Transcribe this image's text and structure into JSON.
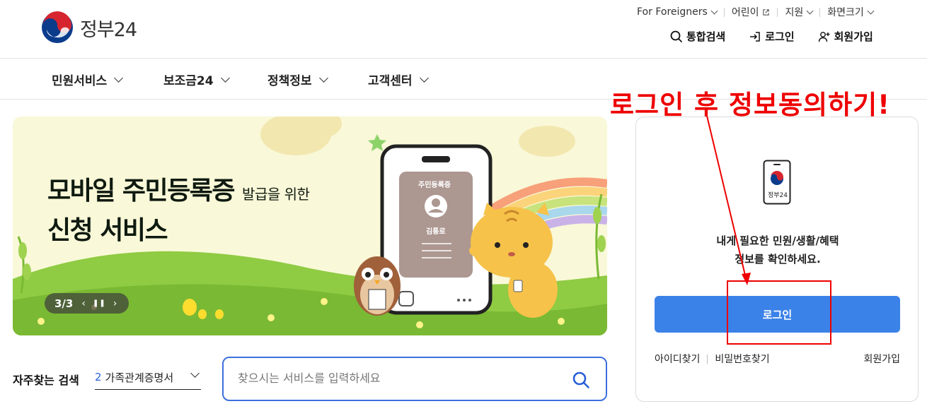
{
  "header": {
    "logo_text": "정부24",
    "util": {
      "foreigners": "For Foreigners",
      "kids": "어린이",
      "region": "지원",
      "font_size": "화면크기"
    },
    "actions": {
      "search": "통합검색",
      "login": "로그인",
      "signup": "회원가입"
    }
  },
  "nav": {
    "items": [
      {
        "label": "민원서비스"
      },
      {
        "label": "보조금24"
      },
      {
        "label": "정책정보"
      },
      {
        "label": "고객센터"
      }
    ]
  },
  "banner": {
    "title_main_1": "모바일 주민등록증",
    "title_small": "발급을 위한",
    "title_main_2": "신청 서비스",
    "card_title": "주민등록증",
    "card_name": "김통로",
    "pager": {
      "current": "3",
      "total": "3",
      "text": "3/3"
    }
  },
  "search": {
    "freq_label": "자주찾는 검색",
    "freq_number": "2",
    "freq_value": "가족관계증명서",
    "placeholder": "찾으시는 서비스를 입력하세요"
  },
  "login_card": {
    "icon_label": "정부24",
    "desc_line1": "내게 필요한 민원/생활/혜택",
    "desc_line2": "정보를 확인하세요.",
    "login_button": "로그인",
    "find_id": "아이디찾기",
    "find_pw": "비밀번호찾기",
    "signup": "회원가입"
  },
  "annotation": {
    "text": "로그인 후 정보동의하기!",
    "color": "#ee0000"
  },
  "colors": {
    "primary": "#3b82e8",
    "search_border": "#3c6fdc",
    "banner_bg": "#f9f8d8"
  }
}
